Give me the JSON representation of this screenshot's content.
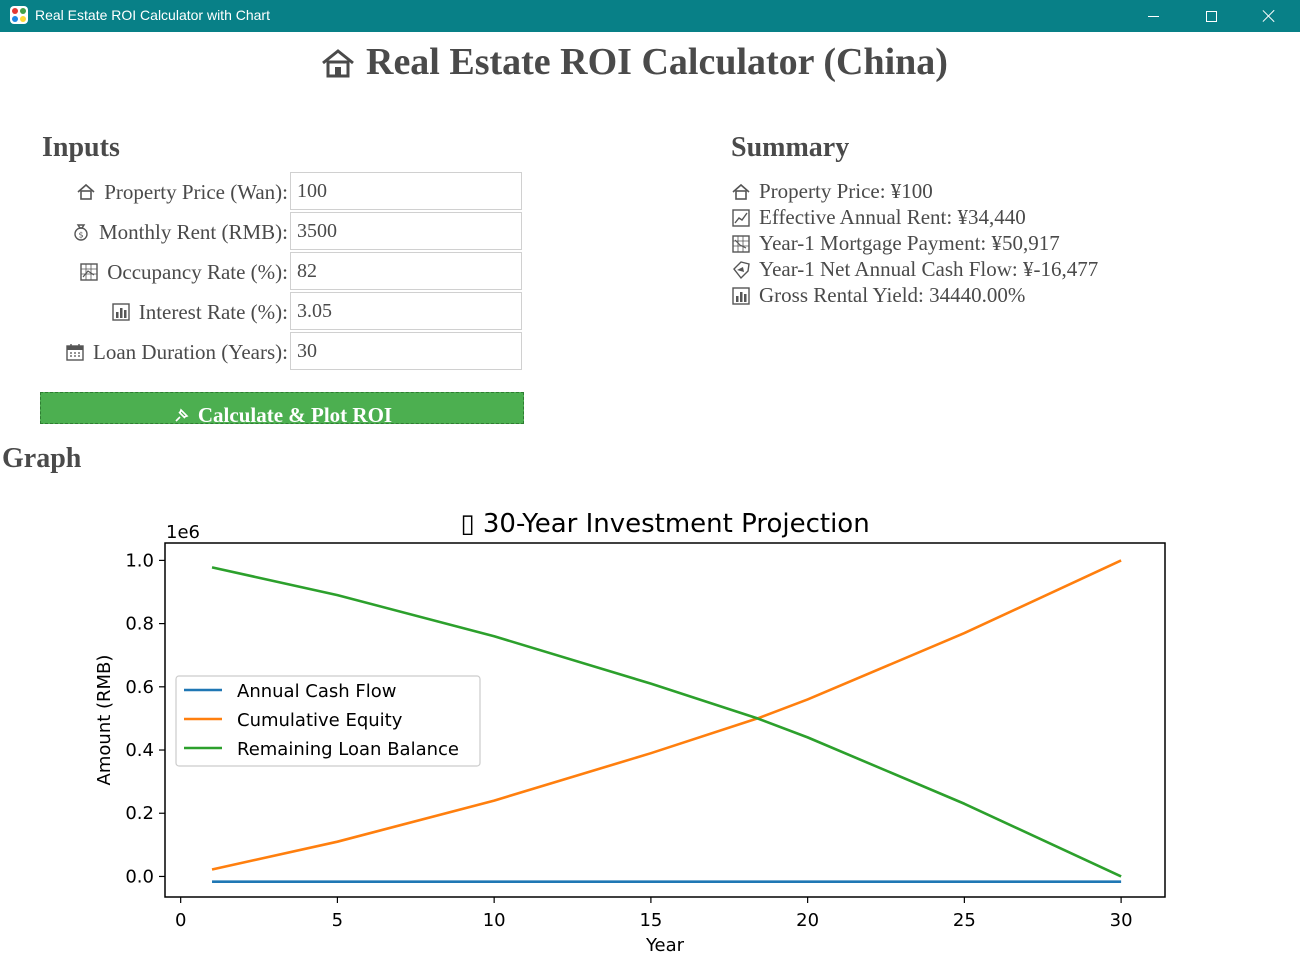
{
  "window": {
    "title": "Real Estate ROI Calculator with Chart"
  },
  "page": {
    "title": "Real Estate ROI Calculator (China)"
  },
  "inputs": {
    "heading": "Inputs",
    "fields": [
      {
        "label": "Property Price (Wan):",
        "value": "100",
        "icon": "house-icon"
      },
      {
        "label": "Monthly Rent (RMB):",
        "value": "3500",
        "icon": "money-bag-icon"
      },
      {
        "label": "Occupancy Rate (%):",
        "value": "82",
        "icon": "grid-chart-icon"
      },
      {
        "label": "Interest Rate (%):",
        "value": "3.05",
        "icon": "bar-chart-icon"
      },
      {
        "label": "Loan Duration (Years):",
        "value": "30",
        "icon": "calendar-icon"
      }
    ],
    "calculate_button": "Calculate & Plot ROI"
  },
  "summary": {
    "heading": "Summary",
    "lines": [
      {
        "text": "Property Price: ¥100",
        "icon": "house-icon"
      },
      {
        "text": "Effective Annual Rent: ¥34,440",
        "icon": "trend-chart-icon"
      },
      {
        "text": "Year-1 Mortgage Payment: ¥50,917",
        "icon": "grid-chart-icon"
      },
      {
        "text": "Year-1 Net Annual Cash Flow: ¥-16,477",
        "icon": "money-tag-icon"
      },
      {
        "text": "Gross Rental Yield: 34440.00%",
        "icon": "bar-chart-icon"
      }
    ]
  },
  "graph": {
    "heading": "Graph"
  },
  "colors": {
    "titlebar": "#088087",
    "button": "#4caf50",
    "cash_flow": "#1f77b4",
    "equity": "#ff7f0e",
    "loan": "#2ca02c"
  },
  "chart_data": {
    "type": "line",
    "title": "▯ 30-Year Investment Projection",
    "xlabel": "Year",
    "ylabel": "Amount (RMB)",
    "offset_label": "1e6",
    "xlim": [
      -0.5,
      31.4
    ],
    "ylim": [
      -0.065,
      1.055
    ],
    "xticks": [
      "0",
      "5",
      "10",
      "15",
      "20",
      "25",
      "30"
    ],
    "yticks": [
      "0.0",
      "0.2",
      "0.4",
      "0.6",
      "0.8",
      "1.0"
    ],
    "legend": "center-left",
    "x": [
      1,
      5,
      10,
      15,
      18.4,
      20,
      25,
      30
    ],
    "series": [
      {
        "name": "Annual Cash Flow",
        "color": "#1f77b4",
        "values": [
          -0.0165,
          -0.0165,
          -0.0165,
          -0.0165,
          -0.0165,
          -0.0165,
          -0.0165,
          -0.0165
        ]
      },
      {
        "name": "Cumulative Equity",
        "color": "#ff7f0e",
        "values": [
          0.022,
          0.11,
          0.24,
          0.39,
          0.5,
          0.56,
          0.77,
          1.0
        ]
      },
      {
        "name": "Remaining Loan Balance",
        "color": "#2ca02c",
        "values": [
          0.978,
          0.89,
          0.76,
          0.61,
          0.5,
          0.44,
          0.23,
          0.0
        ]
      }
    ]
  }
}
